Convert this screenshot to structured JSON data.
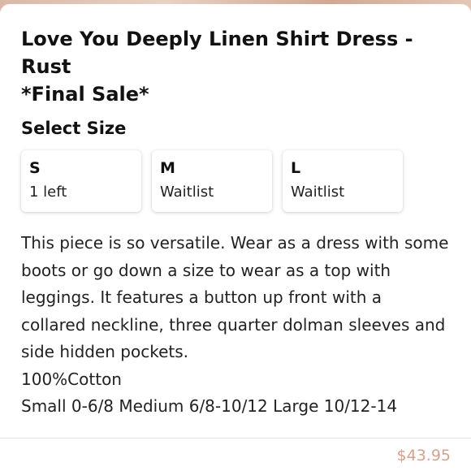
{
  "product": {
    "title_line1": "Love You Deeply Linen Shirt Dress - Rust",
    "title_line2": "*Final Sale*"
  },
  "size_selector": {
    "heading": "Select Size",
    "options": [
      {
        "size": "S",
        "status": "1 left"
      },
      {
        "size": "M",
        "status": "Waitlist"
      },
      {
        "size": "L",
        "status": "Waitlist"
      }
    ]
  },
  "description": {
    "paragraph": "This piece is so versatile. Wear as a dress with some boots or go down a size to wear as a top with leggings. It features a button up front with a collared neckline, three quarter dolman sleeves and side hidden pockets.",
    "material": "100%Cotton",
    "sizing": "Small 0-6/8 Medium 6/8-10/12 Large 10/12-14"
  },
  "footer": {
    "price": "$43.95"
  },
  "colors": {
    "price_accent": "#d9a08a",
    "text": "#111111",
    "background_strip": "#e9e2dd"
  }
}
